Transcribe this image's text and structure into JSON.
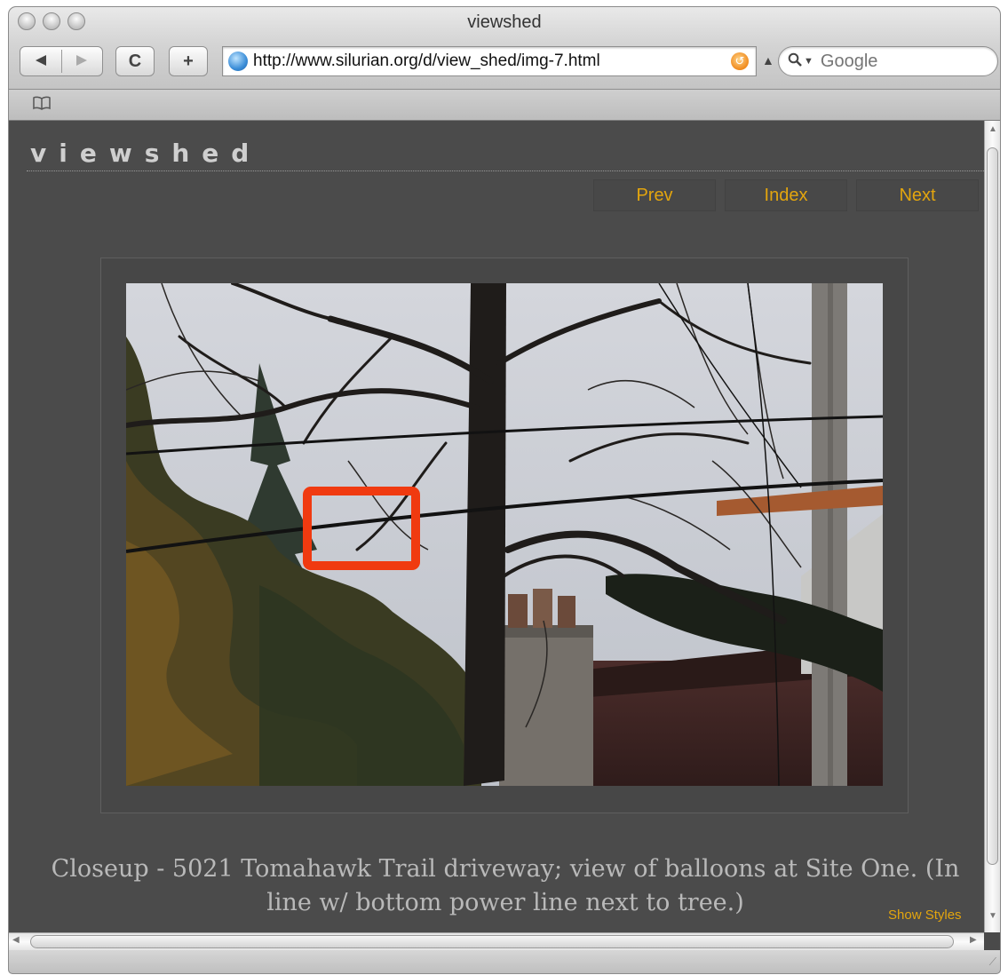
{
  "browser": {
    "window_title": "viewshed",
    "back_icon": "back-arrow-icon",
    "forward_icon": "forward-arrow-icon",
    "reload_glyph": "C",
    "add_bookmark_glyph": "+",
    "url": "http://www.silurian.org/d/view_shed/img-7.html",
    "search_placeholder": "Google",
    "bookmarks_icon": "book-icon"
  },
  "page": {
    "site_title": "viewshed",
    "nav": {
      "prev": "Prev",
      "index": "Index",
      "next": "Next"
    },
    "photo": {
      "description_icon": "photo-trees-power-lines",
      "highlight_color": "#f03a10"
    },
    "caption": "Closeup - 5021 Tomahawk Trail driveway; view of balloons at Site One. (In line w/ bottom power line next to tree.)",
    "show_styles": "Show Styles"
  },
  "colors": {
    "page_background": "#4b4b4b",
    "nav_link": "#e3a50e",
    "caption_text": "#b9b9b9",
    "site_title": "#cfcfcf"
  }
}
